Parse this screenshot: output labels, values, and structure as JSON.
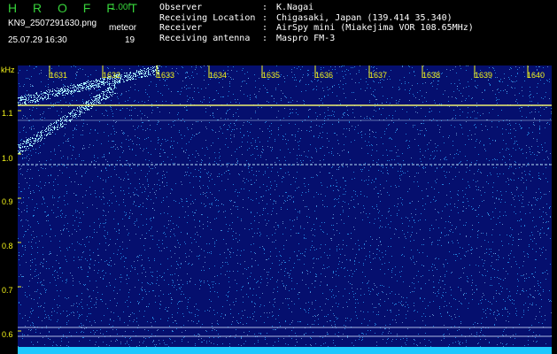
{
  "header": {
    "app_title": "H R O F F T",
    "version": "1.00f",
    "file_name": "KN9_2507291630.png",
    "timestamp": "25.07.29 16:30",
    "mode_label": "meteor",
    "count": "19"
  },
  "info": [
    {
      "key": "Observer",
      "sep": ":",
      "value": "K.Nagai"
    },
    {
      "key": "Receiving Location",
      "sep": ":",
      "value": "Chigasaki, Japan (139.414 35.340)"
    },
    {
      "key": "Receiver",
      "sep": ":",
      "value": "AirSpy mini (Miakejima VOR 108.65MHz)"
    },
    {
      "key": "Receiving antenna",
      "sep": ":",
      "value": "Maspro FM-3"
    }
  ],
  "axis": {
    "y_unit": "kHz",
    "y_ticks": [
      "1.1",
      "1.0",
      "0.9",
      "0.8",
      "0.7",
      "0.6"
    ],
    "x_ticks": [
      "1631",
      "1632",
      "1633",
      "1634",
      "1635",
      "1636",
      "1637",
      "1638",
      "1639",
      "1640"
    ]
  },
  "colors": {
    "background": "#050f6e",
    "noise": "#2ea8ff",
    "carrier": "#f0f070",
    "axis_text": "#f4f41a",
    "title": "#36d13a"
  }
}
